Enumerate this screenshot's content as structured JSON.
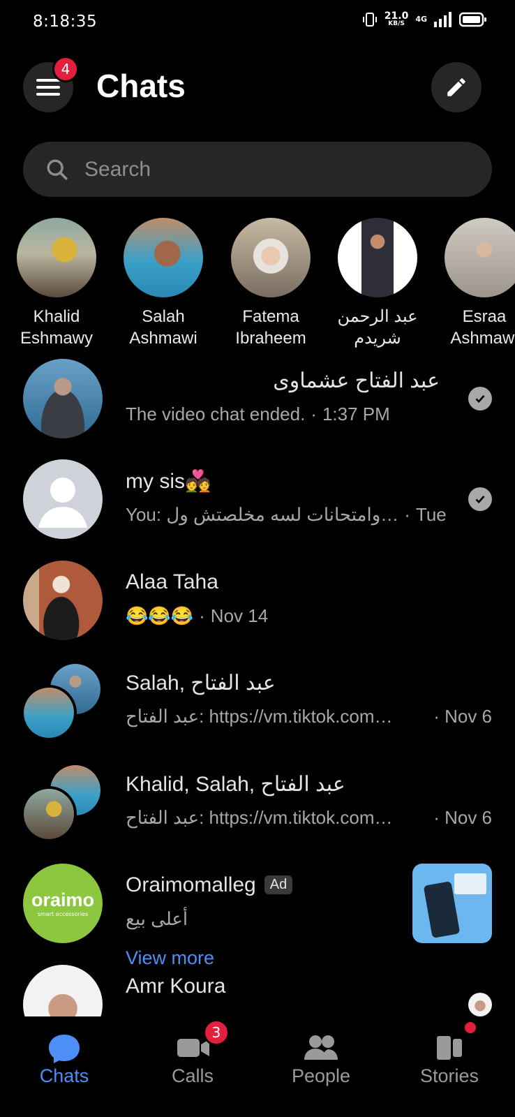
{
  "status_bar": {
    "time": "8:18:35",
    "net_speed": "21.0",
    "net_unit": "KB/S",
    "network": "4G"
  },
  "header": {
    "title": "Chats",
    "menu_badge": "4"
  },
  "search": {
    "placeholder": "Search"
  },
  "stories": [
    {
      "name": "Khalid\nEshmawy"
    },
    {
      "name": "Salah\nAshmawi"
    },
    {
      "name": "Fatema\nIbraheem"
    },
    {
      "name": "عبد الرحمن\nشريدم"
    },
    {
      "name": "Esraa\nAshmawi"
    }
  ],
  "chats": [
    {
      "name": "عبد الفتاح عشماوى",
      "preview": "The video chat ended.",
      "time": "1:37 PM"
    },
    {
      "name": "my sis💑",
      "preview": "You: وامتحانات لسه مخلصتش ول…",
      "time": "Tue"
    },
    {
      "name": "Alaa Taha",
      "preview": "😂😂😂",
      "time": "Nov 14"
    },
    {
      "name": "Salah, عبد الفتاح",
      "preview": "عبد الفتاح: https://vm.tiktok.com…",
      "time": "Nov 6"
    },
    {
      "name": "Khalid, Salah, عبد الفتاح",
      "preview": "عبد الفتاح: https://vm.tiktok.com…",
      "time": "Nov 6"
    }
  ],
  "ad": {
    "name": "Oraimomalleg",
    "tag": "Ad",
    "text": "أعلى بيع",
    "link": "View more",
    "logo_text": "oraimo",
    "logo_sub": "smart accessories"
  },
  "last_chat": {
    "name": "Amr Koura"
  },
  "nav": {
    "chats": "Chats",
    "calls": "Calls",
    "calls_badge": "3",
    "people": "People",
    "stories": "Stories"
  },
  "colors": {
    "accent": "#4e8ef7",
    "badge": "#e41e3f",
    "oraimo_green": "#8dc63f"
  }
}
